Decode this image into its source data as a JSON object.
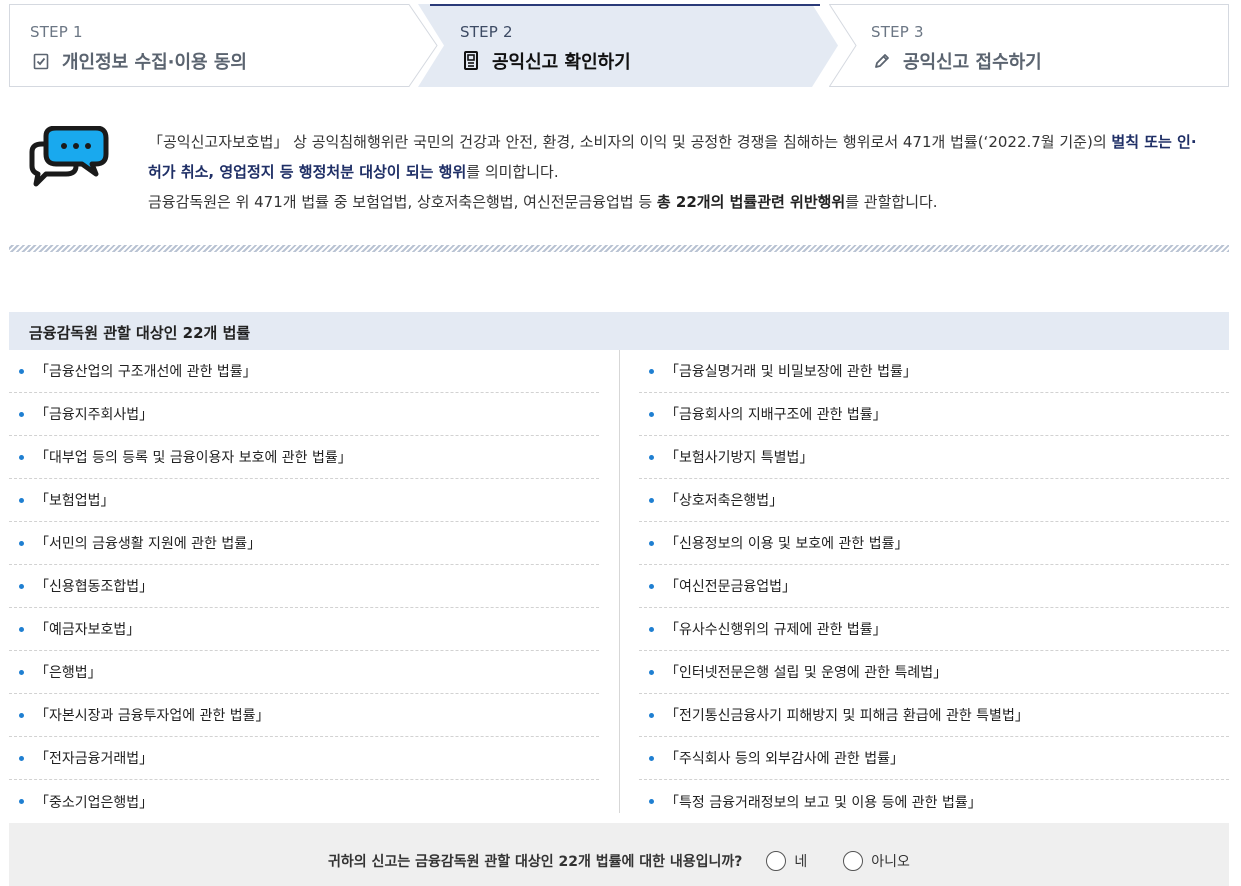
{
  "steps": [
    {
      "num": "STEP 1",
      "title": "개인정보 수집·이용 동의",
      "icon": "checkbox-icon",
      "active": false
    },
    {
      "num": "STEP 2",
      "title": "공익신고 확인하기",
      "icon": "document-icon",
      "active": true
    },
    {
      "num": "STEP 3",
      "title": "공익신고 접수하기",
      "icon": "pencil-icon",
      "active": false
    }
  ],
  "intro": {
    "icon": "chat-bubbles-icon",
    "p1_a": "「공익신고자보호법」 상 공익침해행위란 국민의 건강과 안전, 환경, 소비자의 이익 및 공정한 경쟁을 침해하는 행위로서 471개 법률(‘2022.7월 기준)의 ",
    "p1_bold": "벌칙 또는 인·허가 취소, 영업정지 등 행정처분 대상이 되는 행위",
    "p1_b": "를 의미합니다.",
    "p2_a": "금융감독원은 위 471개 법률 중 보험업법, 상호저축은행법, 여신전문금융업법 등 ",
    "p2_bold": "총 22개의 법률관련 위반행위",
    "p2_b": "를 관할합니다."
  },
  "laws": {
    "header": "금융감독원 관할 대상인 22개 법률",
    "left": [
      "「금융산업의 구조개선에 관한 법률」",
      "「금융지주회사법」",
      "「대부업 등의 등록 및 금융이용자 보호에 관한 법률」",
      "「보험업법」",
      "「서민의 금융생활 지원에 관한 법률」",
      "「신용협동조합법」",
      "「예금자보호법」",
      "「은행법」",
      "「자본시장과 금융투자업에 관한 법률」",
      "「전자금융거래법」",
      "「중소기업은행법」"
    ],
    "right": [
      "「금융실명거래 및 비밀보장에 관한 법률」",
      "「금융회사의 지배구조에 관한 법률」",
      "「보험사기방지 특별법」",
      "「상호저축은행법」",
      "「신용정보의 이용 및 보호에 관한 법률」",
      "「여신전문금융업법」",
      "「유사수신행위의 규제에 관한 법률」",
      "「인터넷전문은행 설립 및 운영에 관한 특례법」",
      "「전기통신금융사기 피해방지 및 피해금 환급에 관한 특별법」",
      "「주식회사 등의 외부감사에 관한 법률」",
      "「특정 금융거래정보의 보고 및 이용 등에 관한 법률」"
    ]
  },
  "question": {
    "text": "귀하의 신고는 금융감독원 관할 대상인 22개 법률에 대한 내용입니까?",
    "yes": "네",
    "no": "아니오"
  },
  "colors": {
    "accent": "#1f7fd1",
    "step_active_bg": "#e4eaf3",
    "step_active_top": "#2a3a78",
    "emphasis": "#1f2f66"
  }
}
